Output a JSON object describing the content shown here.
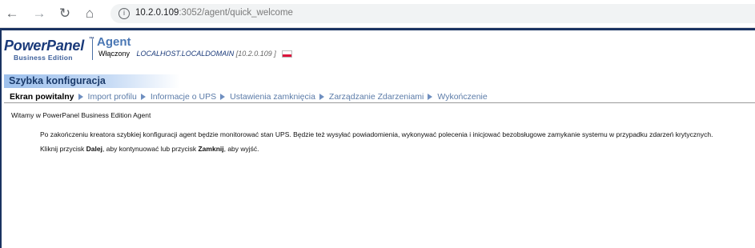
{
  "browser": {
    "url_host": "10.2.0.109",
    "url_path": ":3052/agent/quick_welcome",
    "back_icon": "←",
    "forward_icon": "→",
    "reload_icon": "↻",
    "home_icon": "⌂",
    "info_icon": "i"
  },
  "header": {
    "logo_text": "PowerPanel",
    "logo_tm": "™",
    "logo_edition": "Business Edition",
    "agent_title": "Agent",
    "status": "Włączony",
    "hostname": "LOCALHOST.LOCALDOMAIN",
    "ip": "[10.2.0.109 ]"
  },
  "section": {
    "title": "Szybka konfiguracja"
  },
  "steps": [
    {
      "label": "Ekran powitalny"
    },
    {
      "label": "Import profilu"
    },
    {
      "label": "Informacje o UPS"
    },
    {
      "label": "Ustawienia zamknięcia"
    },
    {
      "label": "Zarządzanie Zdarzeniami"
    },
    {
      "label": "Wykończenie"
    }
  ],
  "content": {
    "welcome": "Witamy w PowerPanel Business Edition Agent",
    "para1": "Po zakończeniu kreatora szybkiej konfiguracji agent będzie monitorować stan UPS. Będzie też wysyłać powiadomienia, wykonywać polecenia i inicjować bezobsługowe zamykanie systemu w przypadku zdarzeń krytycznych.",
    "para2_pre": "Kliknij przycisk ",
    "next_word": "Dalej",
    "para2_mid": ", aby kontynuować lub przycisk ",
    "close_word": "Zamknij",
    "para2_post": ", aby wyjść."
  },
  "colors": {
    "brand_navy": "#1a3361",
    "accent_blue": "#4a77b4",
    "step_link": "#5b7ba8"
  }
}
